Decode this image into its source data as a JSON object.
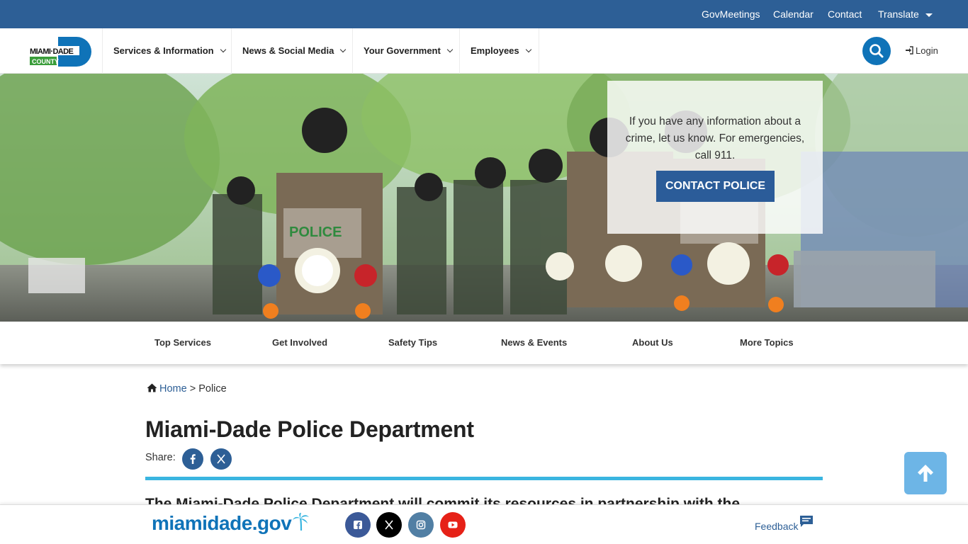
{
  "utility_nav": {
    "items": [
      {
        "label": "GovMeetings"
      },
      {
        "label": "Calendar"
      },
      {
        "label": "Contact"
      },
      {
        "label": "Translate"
      }
    ]
  },
  "logo": {
    "line1": "MIAMI·DADE",
    "line2": "COUNTY"
  },
  "main_nav": {
    "items": [
      {
        "label": "Services & Information"
      },
      {
        "label": "News & Social Media"
      },
      {
        "label": "Your Government"
      },
      {
        "label": "Employees"
      }
    ],
    "login_label": "Login"
  },
  "hero": {
    "callout_text": "If you have any information about a crime, let us know. For emergencies, call 911.",
    "button_label": "CONTACT POLICE",
    "signage": "POLICE"
  },
  "sub_nav": {
    "items": [
      {
        "label": "Top Services"
      },
      {
        "label": "Get Involved"
      },
      {
        "label": "Safety Tips"
      },
      {
        "label": "News & Events"
      },
      {
        "label": "About Us"
      },
      {
        "label": "More Topics"
      }
    ]
  },
  "breadcrumb": {
    "home": "Home",
    "separator": ">",
    "current": "Police"
  },
  "page": {
    "title": "Miami-Dade Police Department",
    "share_label": "Share:",
    "intro": "The Miami-Dade Police Department will commit its resources in partnership with the"
  },
  "footer": {
    "brand": "miamidade.gov",
    "feedback_label": "Feedback",
    "social": [
      {
        "icon": "facebook-icon",
        "color": "#3b5998"
      },
      {
        "icon": "x-icon",
        "color": "#000000"
      },
      {
        "icon": "instagram-icon",
        "color": "#517fa4"
      },
      {
        "icon": "youtube-icon",
        "color": "#e62117"
      }
    ]
  },
  "colors": {
    "utility_bar": "#2d5f96",
    "accent": "#3ab5e0",
    "search": "#0f73b8",
    "button": "#2b5c99"
  }
}
